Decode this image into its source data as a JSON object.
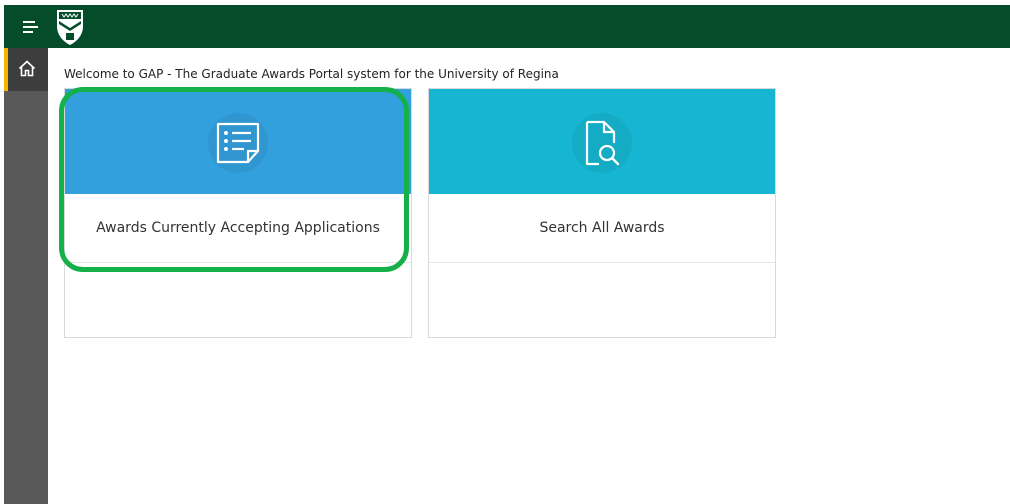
{
  "header": {
    "menu_icon": "hamburger-menu-icon",
    "logo_icon": "university-crest-logo",
    "brand_color": "#044c2a"
  },
  "sidebar": {
    "items": [
      {
        "icon": "home-icon",
        "active": true
      }
    ],
    "accent_color": "#f5b400"
  },
  "main": {
    "welcome_text": "Welcome to GAP - The Graduate Awards Portal system for the University of Regina",
    "tiles": [
      {
        "label": "Awards Currently Accepting Applications",
        "icon": "list-document-icon",
        "color": "#32a0dd",
        "highlighted": true
      },
      {
        "label": "Search All Awards",
        "icon": "document-search-icon",
        "color": "#16b6d2",
        "highlighted": false
      }
    ]
  },
  "highlight_color": "#15b04a"
}
